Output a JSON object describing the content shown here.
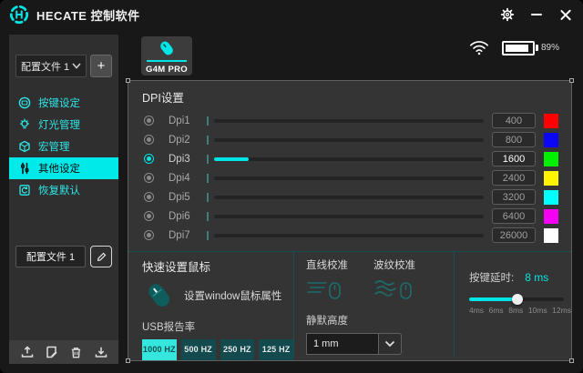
{
  "window": {
    "title": "HECATE 控制软件"
  },
  "status": {
    "battery_percent": "89%"
  },
  "device_tab": {
    "label": "G4M PRO"
  },
  "sidebar": {
    "profile_dropdown": {
      "value": "配置文件 1"
    },
    "add_profile_label": "+",
    "menu": [
      {
        "label": "按键设定",
        "active": false
      },
      {
        "label": "灯光管理",
        "active": false
      },
      {
        "label": "宏管理",
        "active": false
      },
      {
        "label": "其他设定",
        "active": true
      },
      {
        "label": "恢复默认",
        "active": false
      }
    ],
    "profile_name_field": {
      "value": "配置文件 1"
    }
  },
  "dpi_section": {
    "title": "DPI设置",
    "rows": [
      {
        "label": "Dpi1",
        "value": "400",
        "color": "#ff0000",
        "fill": "0%",
        "selected": false
      },
      {
        "label": "Dpi2",
        "value": "800",
        "color": "#0b06f5",
        "fill": "0%",
        "selected": false
      },
      {
        "label": "Dpi3",
        "value": "1600",
        "color": "#00f000",
        "fill": "13%",
        "selected": true
      },
      {
        "label": "Dpi4",
        "value": "2400",
        "color": "#fdf500",
        "fill": "0%",
        "selected": false
      },
      {
        "label": "Dpi5",
        "value": "3200",
        "color": "#00ffff",
        "fill": "0%",
        "selected": false
      },
      {
        "label": "Dpi6",
        "value": "6400",
        "color": "#f400f4",
        "fill": "0%",
        "selected": false
      },
      {
        "label": "Dpi7",
        "value": "26000",
        "color": "#ffffff",
        "fill": "0%",
        "selected": false
      }
    ]
  },
  "quick_section": {
    "title": "快速设置鼠标",
    "window_mouse_label": "设置window鼠标属性",
    "usb_rate_label": "USB报告率",
    "usb_rates": [
      {
        "label": "1000 HZ",
        "selected": true
      },
      {
        "label": "500 HZ",
        "selected": false
      },
      {
        "label": "250 HZ",
        "selected": false
      },
      {
        "label": "125 HZ",
        "selected": false
      }
    ],
    "line_calibration_label": "直线校准",
    "ripple_calibration_label": "波纹校准",
    "lod_label": "静默高度",
    "lod_value": "1 mm",
    "delay_label": "按键延时:",
    "delay_value": "8 ms",
    "delay_fill": "51%",
    "delay_ticks": [
      "4ms",
      "6ms",
      "8ms",
      "10ms",
      "12ms"
    ]
  },
  "colors": {
    "accent": "#00e5e5",
    "menu_highlight": "#00eaea",
    "rate_selected_bg": "#35e6df"
  }
}
